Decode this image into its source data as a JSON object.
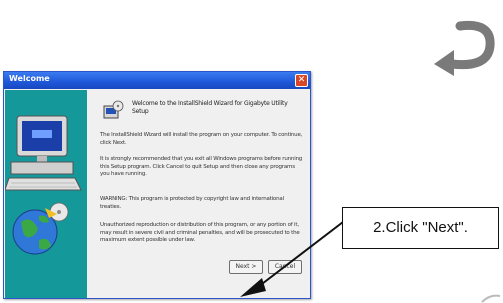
{
  "dialog": {
    "title": "Welcome",
    "welcome_text": "Welcome to the InstallShield Wizard for Gigabyte Utility Setup",
    "paragraphs": [
      "The InstallShield Wizard will install the program on your computer. To continue, click Next.",
      "It is strongly recommended that you exit all Windows programs before running this Setup program. Click Cancel to quit Setup and then close any programs you have running.",
      "WARNING: This program is protected by copyright law and international treaties.",
      "Unauthorized reproduction or distribution of this program, or any portion of it, may result in severe civil and criminal penalties, and will be prosecuted to the maximum extent possible under law."
    ],
    "next_label": "Next >",
    "cancel_label": "Cancel"
  },
  "callout": {
    "text": "2.Click \"Next\"."
  },
  "colors": {
    "title_bar": "#1e57d8",
    "side_panel": "#14989a",
    "close_button": "#d8462a"
  }
}
